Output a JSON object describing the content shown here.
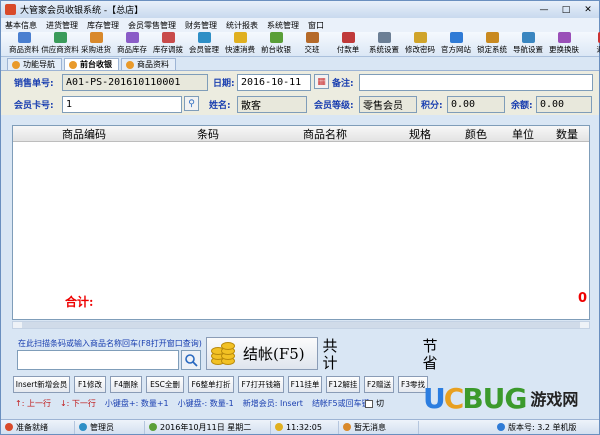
{
  "window": {
    "title": "大管家会员收银系统 -【总店】"
  },
  "menu": [
    "基本信息",
    "进货管理",
    "库存管理",
    "会员零售管理",
    "财务管理",
    "统计报表",
    "系统管理",
    "窗口"
  ],
  "toolbar": [
    {
      "label": "商品资料",
      "icon": "box-icon",
      "color": "#4a7fd0"
    },
    {
      "label": "供应商资料",
      "icon": "supplier-icon",
      "color": "#3a9b5a"
    },
    {
      "label": "采购进货",
      "icon": "truck-icon",
      "color": "#d9892b"
    },
    {
      "label": "商品库存",
      "icon": "warehouse-icon",
      "color": "#8a5cc7"
    },
    {
      "label": "库存调拨",
      "icon": "transfer-icon",
      "color": "#c94b4b"
    },
    {
      "label": "会员管理",
      "icon": "member-icon",
      "color": "#2e8fc6"
    },
    {
      "label": "快速消费",
      "icon": "lightning-icon",
      "color": "#e0b020"
    },
    {
      "label": "前台收银",
      "icon": "register-icon",
      "color": "#5a9f38"
    },
    {
      "label": "交班",
      "icon": "handover-icon",
      "color": "#b56a2a"
    },
    {
      "label": "付款单",
      "icon": "payment-icon",
      "color": "#c03a3a"
    },
    {
      "label": "系统设置",
      "icon": "gear-icon",
      "color": "#6c7f95"
    },
    {
      "label": "修改密码",
      "icon": "key-icon",
      "color": "#d0a42a"
    },
    {
      "label": "官方网站",
      "icon": "globe-icon",
      "color": "#2f7bd6"
    },
    {
      "label": "锁定系统",
      "icon": "lock-icon",
      "color": "#c98a20"
    },
    {
      "label": "导航设置",
      "icon": "nav-icon",
      "color": "#3a86c0"
    },
    {
      "label": "更换换肤",
      "icon": "skin-icon",
      "color": "#9a4fb8"
    },
    {
      "label": "退出",
      "icon": "exit-icon",
      "color": "#cc3333"
    }
  ],
  "tabs": [
    {
      "label": "功能导航",
      "active": false
    },
    {
      "label": "前台收银",
      "active": true
    },
    {
      "label": "商品资料",
      "active": false
    }
  ],
  "form": {
    "sale_no_label": "销售单号:",
    "sale_no": "A01-PS-201610110001",
    "date_label": "日期:",
    "date": "2016-10-11",
    "remark_label": "备注:",
    "remark": "",
    "card_label": "会员卡号:",
    "card": "1",
    "name_label": "姓名:",
    "name": "散客",
    "level_label": "会员等级:",
    "level": "零售会员",
    "points_label": "积分:",
    "points": "0.00",
    "balance_label": "余额:",
    "balance": "0.00"
  },
  "grid": {
    "columns": [
      "商品编码",
      "条码",
      "商品名称",
      "规格",
      "颜色",
      "单位",
      "数量"
    ],
    "total_label": "合计:",
    "total_value": "0"
  },
  "bottom": {
    "scan_hint": "在此扫描条码或输入商品名称回车(F8打开窗口查询)",
    "scan_value": "",
    "checkout_label": "结帐(F5)",
    "total_chars": [
      "共",
      "计"
    ],
    "saved_chars": [
      "节",
      "省"
    ],
    "fkeys": [
      "Insert新增会员",
      "F1修改",
      "F4删除",
      "ESC全删",
      "F6整单打折",
      "F7打开钱箱",
      "F11挂单",
      "F12解挂",
      "F2赠送",
      "F3零找"
    ],
    "hints": [
      "↑: 上一行",
      "↓: 下一行",
      "小键盘+: 数量+1",
      "小键盘-: 数量-1",
      "新增会员: Insert",
      "结帐F5或回车键"
    ],
    "check_label": "切"
  },
  "status": {
    "ready": "准备就绪",
    "user": "管理员",
    "datetime": "2016年10月11日 星期二",
    "time": "11:32:05",
    "message": "暂无消息",
    "version": "版本号: 3.2 单机版"
  },
  "watermark": {
    "u": "U",
    "c": "C",
    "bug": "BUG",
    "cn": "游戏网",
    "site": ".com"
  },
  "colors": {
    "label_blue": "#1a3fb0",
    "total_red": "#e00000",
    "chrome": "#d9e6f4"
  }
}
